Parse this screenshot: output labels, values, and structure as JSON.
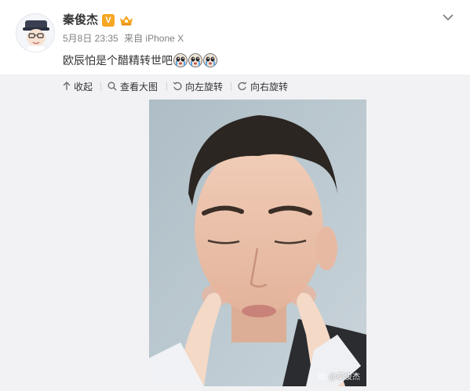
{
  "post": {
    "author": "秦俊杰",
    "verified_badge": "V",
    "date": "5月8日 23:35",
    "source_prefix": "来自",
    "source": "iPhone X",
    "text": "欧辰怕是个醋精转世吧",
    "emoji_count": 3
  },
  "toolbar": {
    "collapse": "收起",
    "view_large": "查看大图",
    "rotate_left": "向左旋转",
    "rotate_right": "向右旋转"
  },
  "image": {
    "watermark": "@秦俊杰"
  },
  "colors": {
    "badge": "#f5a623",
    "toolbar_bg": "#f2f2f5",
    "meta_text": "#808080"
  }
}
